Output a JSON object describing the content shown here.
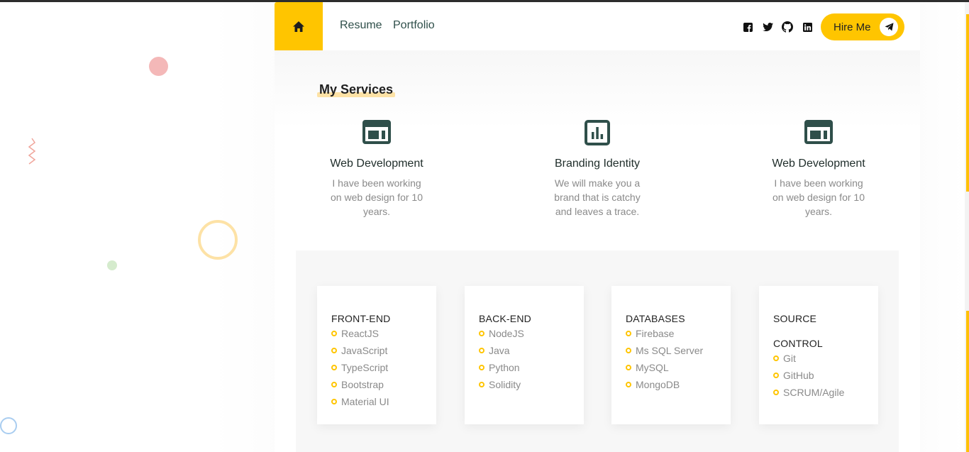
{
  "nav": {
    "links": [
      "Resume",
      "Portfolio"
    ],
    "hire_label": "Hire Me",
    "home_icon": "home-icon",
    "social_icons": [
      "facebook-icon",
      "twitter-icon",
      "github-icon",
      "linkedin-icon"
    ],
    "accent_color": "#ffc500"
  },
  "services": {
    "title": "My Services",
    "items": [
      {
        "icon": "web-layout-icon",
        "title": "Web Development",
        "description": "I have been working on web design for 10 years."
      },
      {
        "icon": "bar-chart-icon",
        "title": "Branding Identity",
        "description": "We will make you a brand that is catchy and leaves a trace."
      },
      {
        "icon": "web-layout-icon",
        "title": "Web Development",
        "description": "I have been working on web design for 10 years."
      }
    ]
  },
  "skills": [
    {
      "title": "FRONT-END",
      "items": [
        "ReactJS",
        "JavaScript",
        "TypeScript",
        "Bootstrap",
        "Material UI"
      ]
    },
    {
      "title": "BACK-END",
      "items": [
        "NodeJS",
        "Java",
        "Python",
        "Solidity"
      ]
    },
    {
      "title": "DATABASES",
      "items": [
        "Firebase",
        "Ms SQL Server",
        "MySQL",
        "MongoDB"
      ]
    },
    {
      "title": "SOURCE CONTROL",
      "items": [
        "Git",
        "GitHub",
        "SCRUM/Agile"
      ]
    }
  ]
}
